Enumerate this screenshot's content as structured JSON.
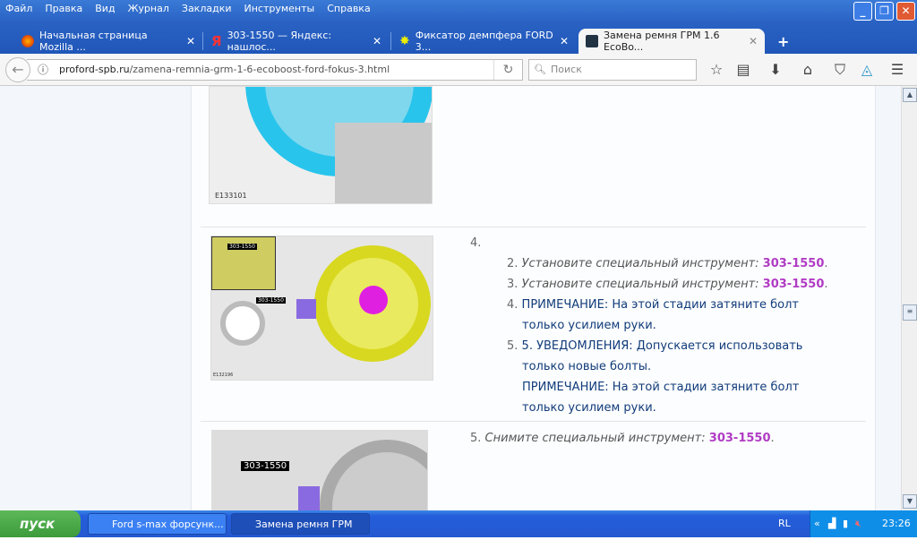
{
  "menu": [
    "Файл",
    "Правка",
    "Вид",
    "Журнал",
    "Закладки",
    "Инструменты",
    "Справка"
  ],
  "tabs": [
    {
      "label": "Начальная страница Mozilla ...",
      "icon": "firefox-icon"
    },
    {
      "label": "303-1550 — Яндекс: нашлос...",
      "icon": "yandex-icon"
    },
    {
      "label": "Фиксатор демпфера FORD 3...",
      "icon": "star-badge-icon"
    },
    {
      "label": "Замена ремня ГРМ 1.6 EcoBo...",
      "icon": "site-icon",
      "active": true
    }
  ],
  "url": {
    "host": "proford-spb.ru",
    "path": "/zamena-remnia-grm-1-6-ecoboost-ford-fokus-3.html"
  },
  "search": {
    "placeholder": "Поиск"
  },
  "content": {
    "image1_label": "E133101",
    "image2_labels": [
      "303-1550",
      "303-1550",
      "E132196"
    ],
    "image3_label": "303-1550",
    "step4": {
      "num": "4.",
      "items": [
        {
          "num": "2.",
          "text": "Установите специальный инструмент:",
          "code": "303-1550",
          "end": "."
        },
        {
          "num": "3.",
          "text": "Установите специальный инструмент:",
          "code": "303-1550",
          "end": "."
        },
        {
          "num": "4.",
          "line1": "ПРИМЕЧАНИЕ: На этой стадии затяните болт",
          "line2": "только усилием руки."
        },
        {
          "num": "5.",
          "line1": "5. УВЕДОМЛЕНИЯ: Допускается использовать",
          "line2": "только новые болты.",
          "line3": "ПРИМЕЧАНИЕ: На этой стадии затяните болт",
          "line4": "только усилием руки."
        }
      ]
    },
    "step5": {
      "num": "5.",
      "text": "Снимите специальный инструмент:",
      "code": "303-1550",
      "end": "."
    }
  },
  "taskbar": {
    "start": "пуск",
    "tasks": [
      "Ford s-max форсунк...",
      "Замена ремня ГРМ 1..."
    ],
    "lang": "RL",
    "time": "23:26"
  }
}
